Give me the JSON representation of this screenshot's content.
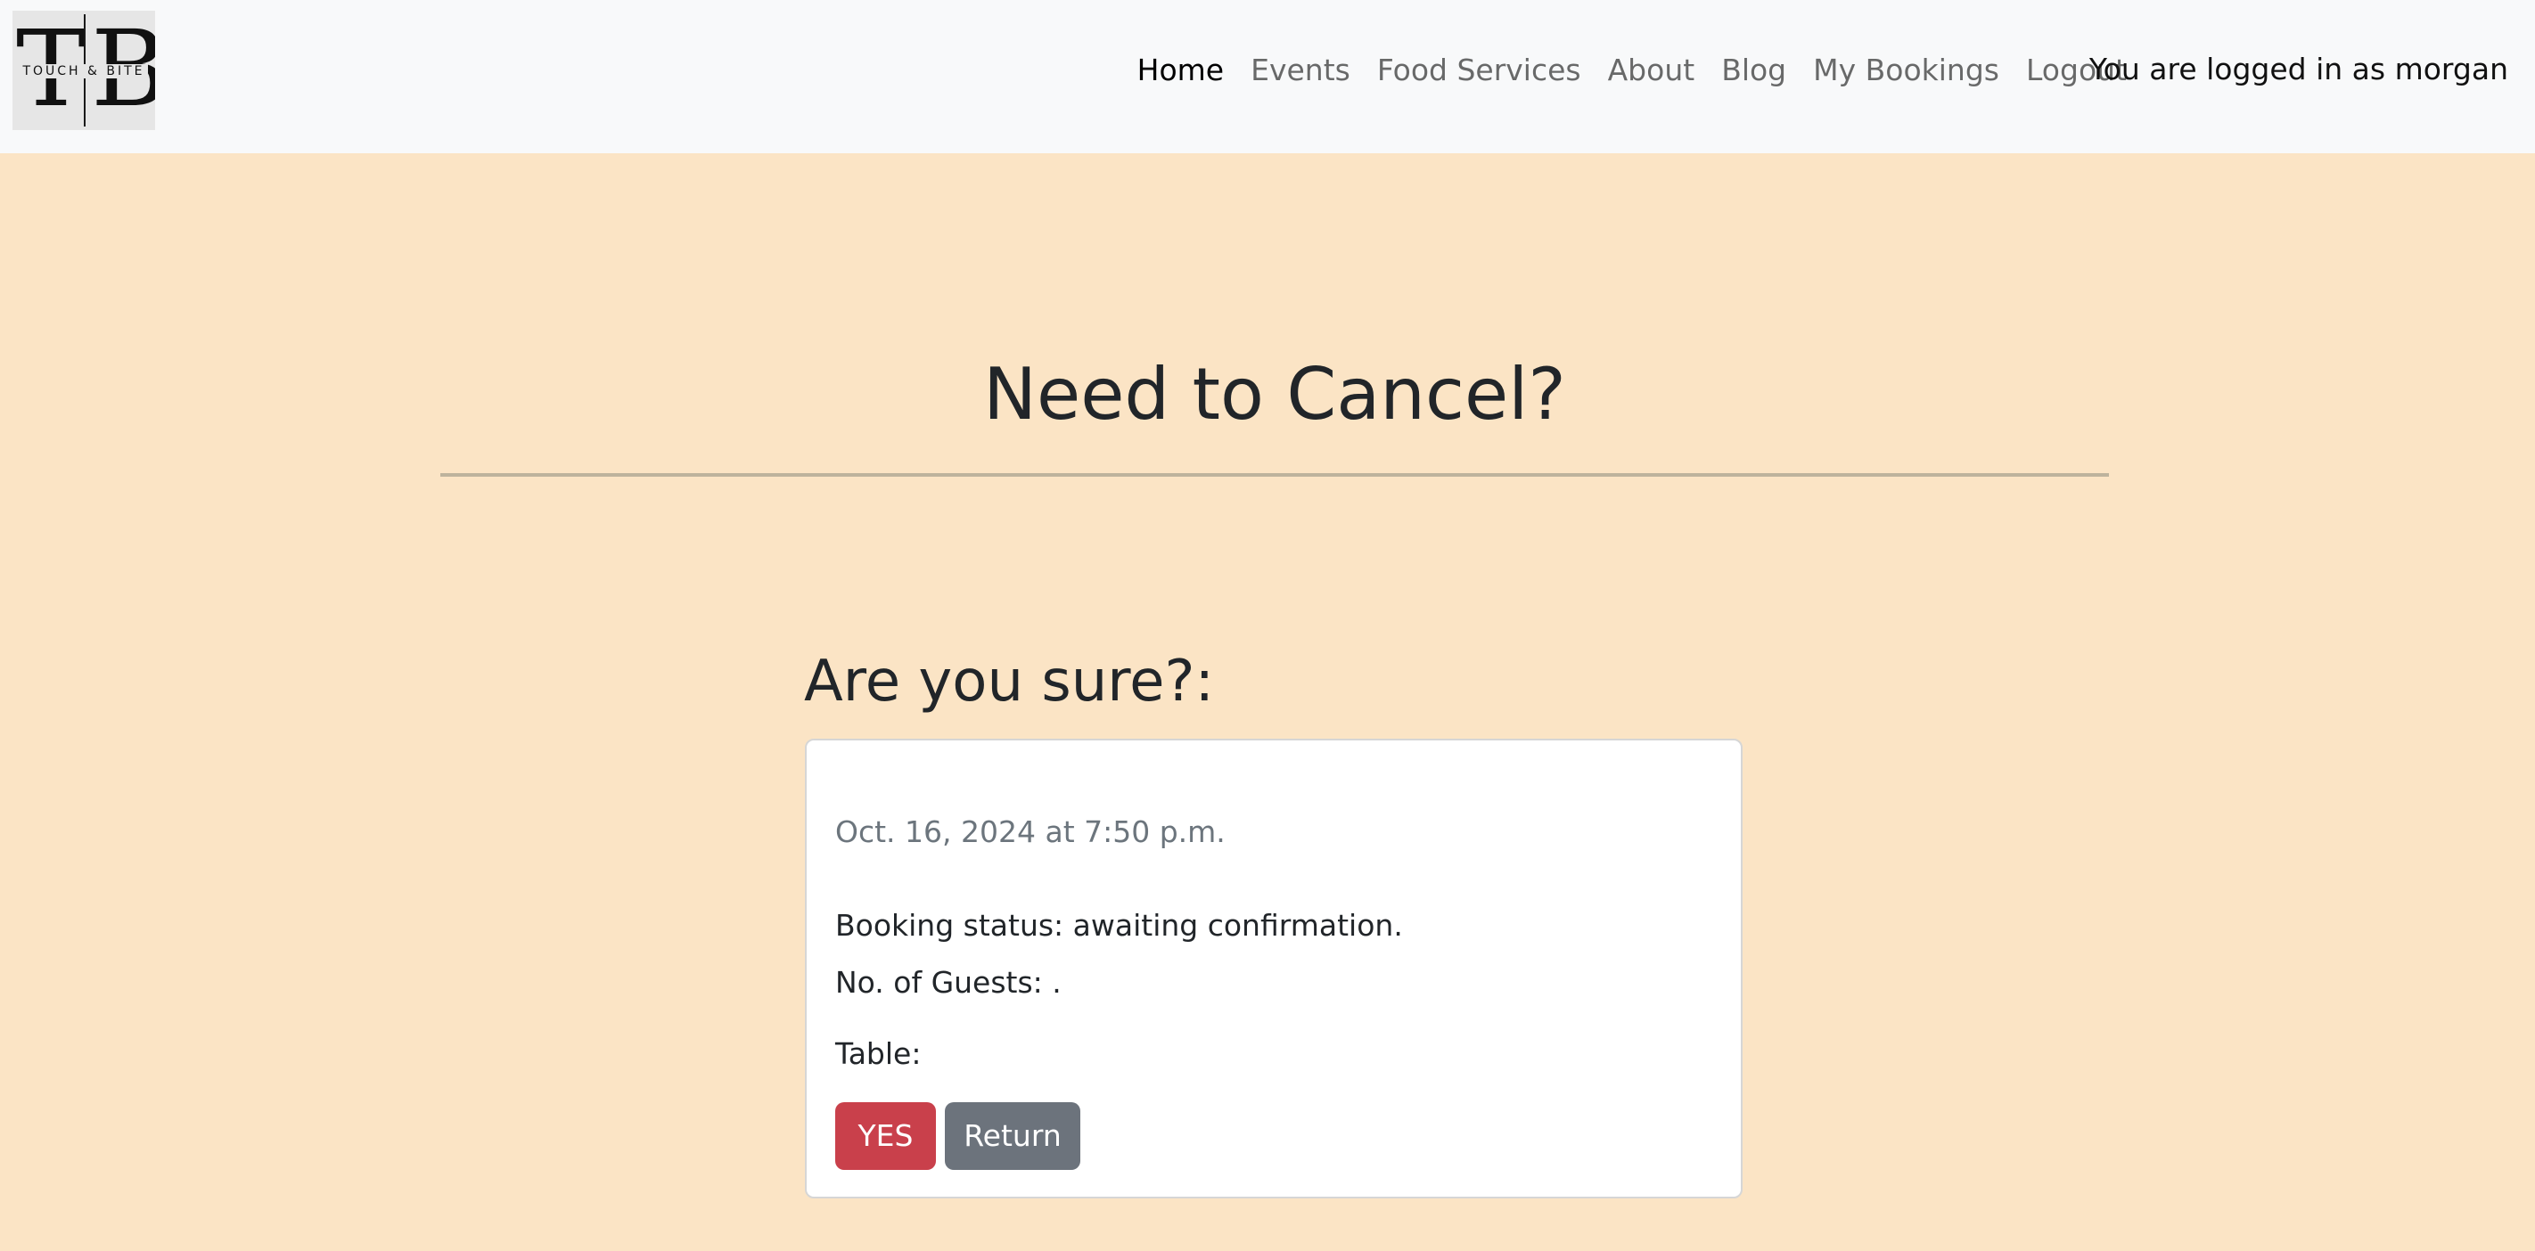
{
  "navbar": {
    "logo": {
      "letter_left": "T",
      "letter_right": "B",
      "tagline": "TOUCH & BITE"
    },
    "links": [
      {
        "label": "Home",
        "active": true
      },
      {
        "label": "Events",
        "active": false
      },
      {
        "label": "Food Services",
        "active": false
      },
      {
        "label": "About",
        "active": false
      },
      {
        "label": "Blog",
        "active": false
      },
      {
        "label": "My Bookings",
        "active": false
      },
      {
        "label": "Logout",
        "active": false
      }
    ],
    "logged_in_text": "You are logged in as morgan"
  },
  "main": {
    "title": "Need to Cancel?",
    "confirm_heading": "Are you sure?:",
    "booking": {
      "date": "Oct. 16, 2024 at 7:50 p.m.",
      "status": "Booking status: awaiting confirmation.",
      "guests": "No. of Guests: .",
      "table": "Table:"
    },
    "buttons": {
      "yes_label": "YES",
      "return_label": "Return"
    }
  },
  "colors": {
    "page_background": "#fbe4c5",
    "navbar_background": "#f8f9fa",
    "danger": "#c9404b",
    "secondary": "#6c737c"
  }
}
